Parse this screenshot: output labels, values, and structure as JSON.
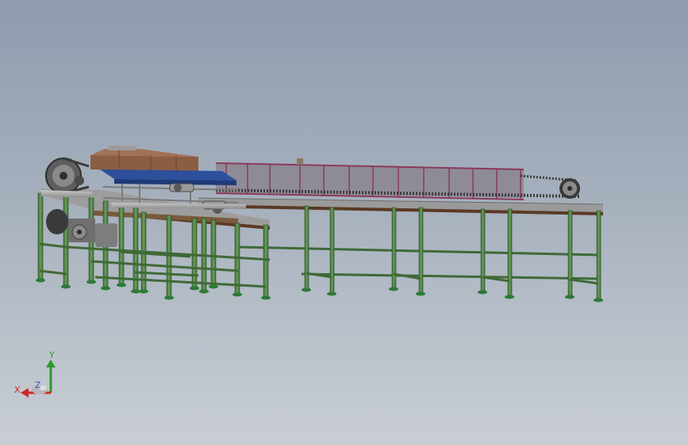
{
  "triad": {
    "x_label": "X",
    "y_label": "Y",
    "z_label": "Z"
  }
}
